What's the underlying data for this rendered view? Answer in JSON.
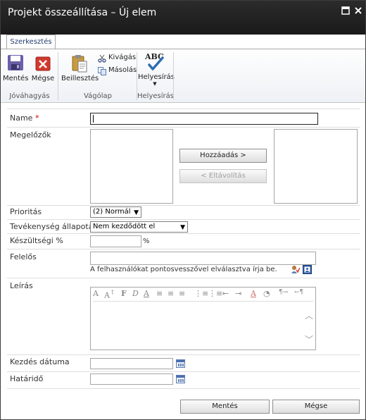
{
  "window": {
    "title": "Projekt összeállítása – Új elem"
  },
  "ribbon": {
    "tab": "Szerkesztés",
    "buttons": {
      "save": "Mentés",
      "cancel": "Mégse",
      "paste": "Beillesztés",
      "cut": "Kivágás",
      "copy": "Másolás",
      "spelling": "Helyesírás",
      "spelling_icon_text": "ABC"
    },
    "groups": {
      "commit": "Jóváhagyás",
      "clipboard": "Vágólap",
      "spelling": "Helyesírás"
    }
  },
  "form": {
    "name": {
      "label": "Name",
      "required_mark": "*",
      "value": ""
    },
    "predecessors": {
      "label": "Megelőzők",
      "add": "Hozzáadás >",
      "remove": "< Eltávolítás"
    },
    "priority": {
      "label": "Prioritás",
      "value": "(2) Normál"
    },
    "status": {
      "label": "Tevékenység állapota",
      "value": "Nem kezdődött el"
    },
    "percent": {
      "label": "Készültségi %",
      "value": "",
      "unit": "%"
    },
    "assigned": {
      "label": "Felelős",
      "value": "",
      "hint": "A felhasználókat pontosvesszővel elválasztva írja be."
    },
    "description": {
      "label": "Leírás"
    },
    "start": {
      "label": "Kezdés dátuma",
      "value": ""
    },
    "due": {
      "label": "Határidő",
      "value": ""
    }
  },
  "footer": {
    "save": "Mentés",
    "cancel": "Mégse"
  },
  "colors": {
    "titlebar": "#1a1a1a",
    "required": "#cc0000",
    "save_icon": "#6a5fa8",
    "cancel_icon": "#d03a2f",
    "check": "#2f6db5"
  }
}
